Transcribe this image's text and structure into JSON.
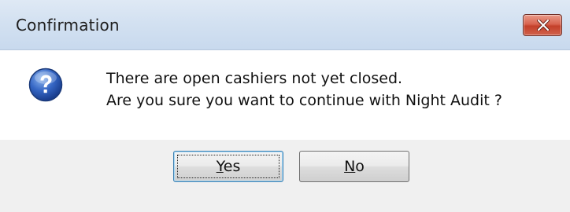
{
  "window": {
    "title": "Confirmation"
  },
  "message": {
    "line1": "There are open cashiers not yet closed.",
    "line2": "Are you sure you want to continue with Night Audit ?"
  },
  "icons": {
    "message_icon": "question-icon",
    "close_icon": "close-icon"
  },
  "buttons": {
    "yes": {
      "mnemonic": "Y",
      "rest": "es"
    },
    "no": {
      "mnemonic": "N",
      "rest": "o"
    }
  },
  "colors": {
    "close_button": "#c74a35",
    "icon_blue": "#2f64b7"
  }
}
